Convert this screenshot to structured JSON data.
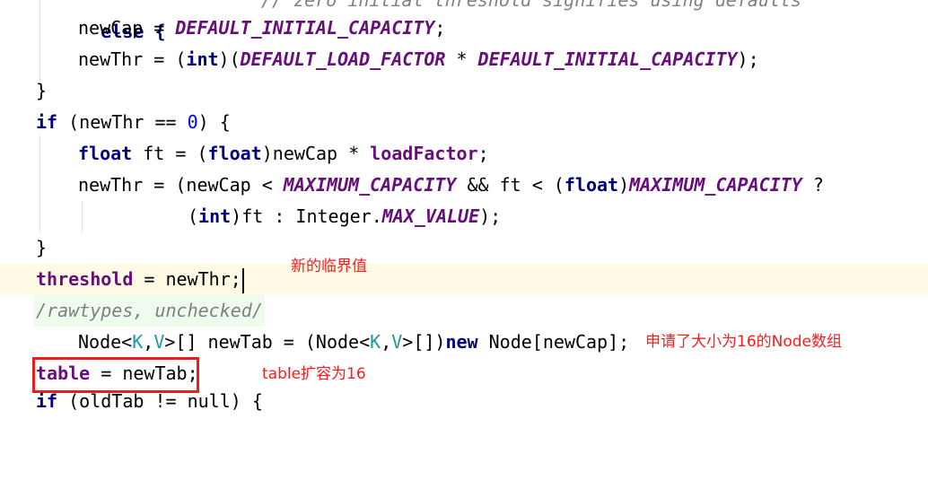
{
  "code_lines": {
    "l0_else": "else {",
    "l0_comment": "// zero initial threshold signifies using defaults",
    "l1_a": "newCap = ",
    "l1_const": "DEFAULT_INITIAL_CAPACITY",
    "l1_b": ";",
    "l2_a": "newThr = (",
    "l2_kw": "int",
    "l2_b": ")(",
    "l2_const1": "DEFAULT_LOAD_FACTOR",
    "l2_c": " * ",
    "l2_const2": "DEFAULT_INITIAL_CAPACITY",
    "l2_d": ");",
    "l3_brace": "}",
    "l4_kw": "if",
    "l4_a": " (newThr == ",
    "l4_num": "0",
    "l4_b": ") {",
    "l5_kw": "float",
    "l5_a": " ft = (",
    "l5_kw2": "float",
    "l5_b": ")newCap * ",
    "l5_fld": "loadFactor",
    "l5_c": ";",
    "l6_a": "newThr = (newCap < ",
    "l6_const1": "MAXIMUM_CAPACITY",
    "l6_b": " && ft < (",
    "l6_kw": "float",
    "l6_c": ")",
    "l6_const2": "MAXIMUM_CAPACITY",
    "l6_d": " ?",
    "l7_a": "(",
    "l7_kw": "int",
    "l7_b": ")ft : Integer.",
    "l7_const": "MAX_VALUE",
    "l7_c": ");",
    "l8_brace": "}",
    "l9_fld": "threshold",
    "l9_a": " = newThr;",
    "l10_sup": "/rawtypes, unchecked/",
    "l11_a": "Node<",
    "l11_tp1": "K",
    "l11_b": ",",
    "l11_tp2": "V",
    "l11_c": ">[] newTab = (Node<",
    "l11_tp3": "K",
    "l11_d": ",",
    "l11_tp4": "V",
    "l11_e": ">[])",
    "l11_kw": "new",
    "l11_f": " Node[newCap];",
    "l12_fld": "table",
    "l12_a": " = newTab;",
    "l13_kw": "if",
    "l13_a": " (oldTab != null) {"
  },
  "annotations": {
    "new_threshold": "新的临界值",
    "node_array": "申请了大小为16的Node数组",
    "table_expand": "table扩容为16"
  },
  "colors": {
    "annotation_red": "#ff1a1a",
    "keyword": "#000080",
    "field": "#660e7a",
    "number": "#0000ff",
    "type_param": "#20999d",
    "current_line_bg": "#fffae3"
  }
}
